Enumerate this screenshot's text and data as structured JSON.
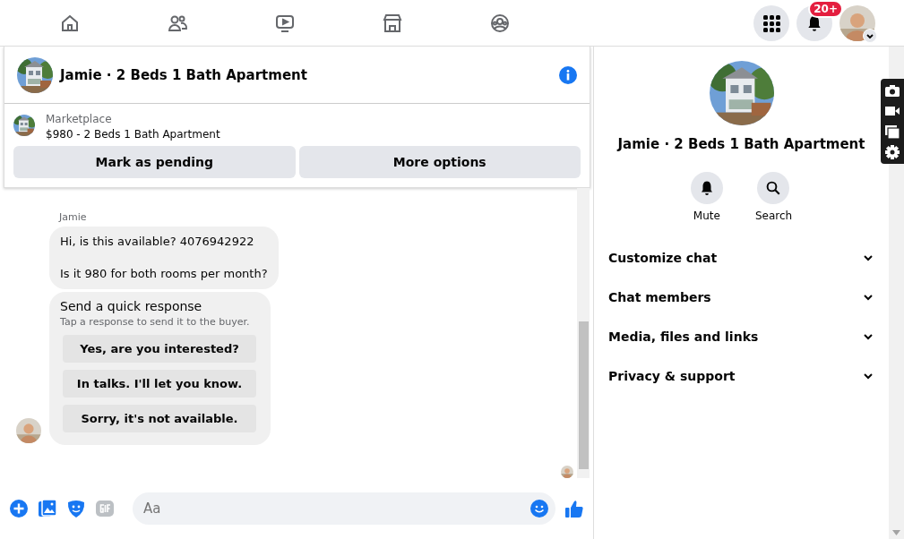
{
  "top_nav": {
    "notification_badge": "20+"
  },
  "chat_header": {
    "title": "Jamie · 2 Beds 1 Bath Apartment"
  },
  "listing": {
    "source": "Marketplace",
    "summary": "$980 - 2 Beds 1 Bath Apartment",
    "actions": [
      "Mark as pending",
      "More options"
    ]
  },
  "messages": [
    {
      "sender": "Jamie",
      "paragraphs": [
        "Hi, is this available? 4076942922",
        "Is it 980 for both rooms per month?"
      ]
    }
  ],
  "quick_response": {
    "title": "Send a quick response",
    "subtitle": "Tap a response to send it to the buyer.",
    "options": [
      "Yes, are you interested?",
      "In talks. I'll let you know.",
      "Sorry, it's not available."
    ]
  },
  "composer": {
    "placeholder": "Aa"
  },
  "details": {
    "title": "Jamie · 2 Beds 1 Bath Apartment",
    "actions": [
      {
        "kind": "mute",
        "label": "Mute"
      },
      {
        "kind": "search",
        "label": "Search"
      }
    ],
    "sections": [
      "Customize chat",
      "Chat members",
      "Media, files and links",
      "Privacy & support"
    ]
  }
}
